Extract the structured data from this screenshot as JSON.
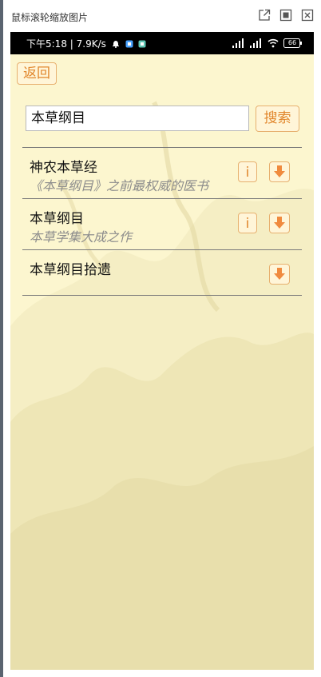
{
  "viewer": {
    "title": "鼠标滚轮缩放图片",
    "controls": [
      "external-link-icon",
      "maximize-icon",
      "close-icon"
    ]
  },
  "status_bar": {
    "text": "下午5:18 | 7.9K/s",
    "right_icons": [
      "hd-signal-icon",
      "hd-signal-icon",
      "wifi-icon",
      "battery-icon"
    ],
    "battery_label": "66"
  },
  "toolbar": {
    "back_label": "返回"
  },
  "search": {
    "value": "本草纲目",
    "button_label": "搜索"
  },
  "results": [
    {
      "title": "神农本草经",
      "subtitle": "《本草纲目》之前最权威的医书",
      "info_label": "i",
      "has_info": true
    },
    {
      "title": "本草纲目",
      "subtitle": "本草学集大成之作",
      "info_label": "i",
      "has_info": true
    },
    {
      "title": "本草纲目拾遗",
      "subtitle": "",
      "has_info": false
    }
  ],
  "colors": {
    "accent": "#e1862c",
    "accent_border": "#e7b06f",
    "background": "#fcf6cf",
    "download_arrow": "#f08a3e"
  }
}
